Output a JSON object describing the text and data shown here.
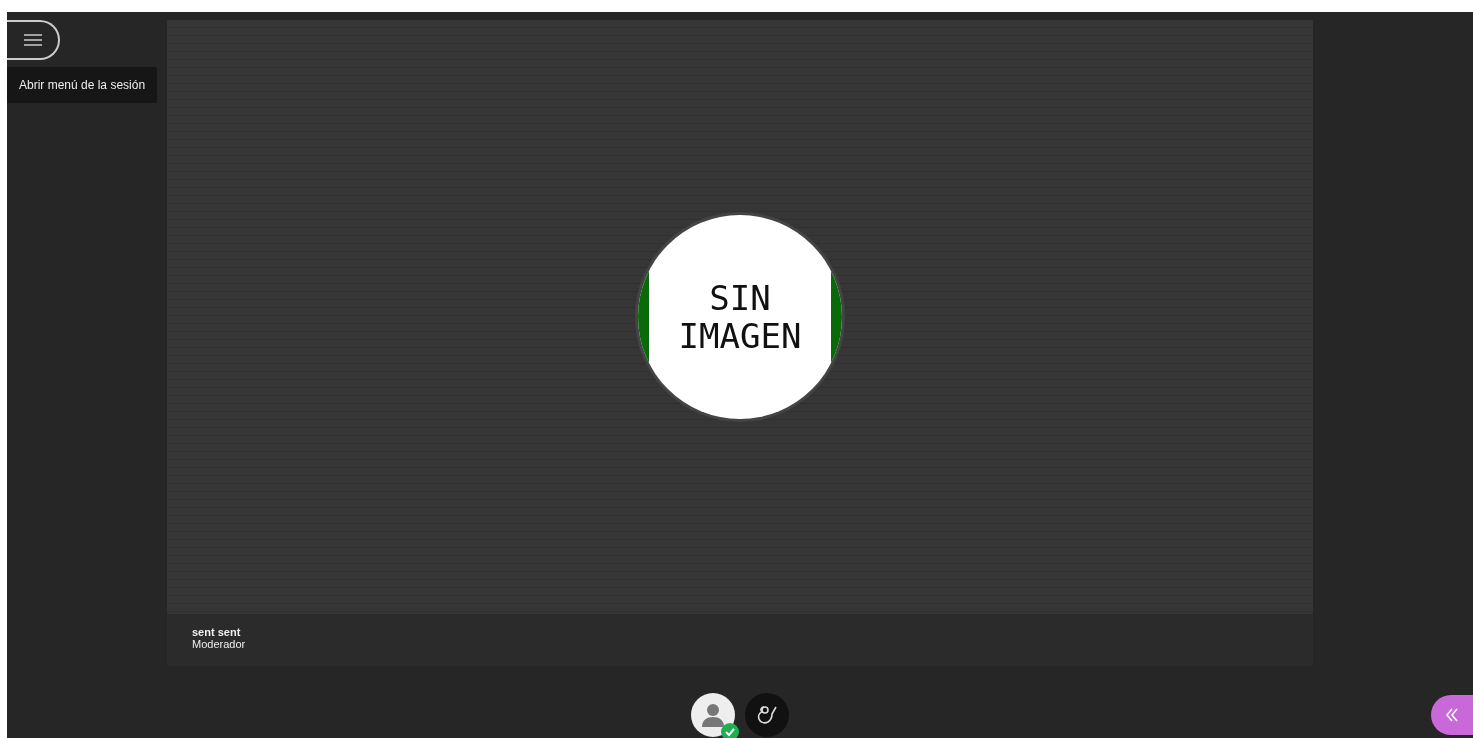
{
  "menu_button": {
    "tooltip": "Abrir menú de la sesión"
  },
  "video_tile": {
    "placeholder_text": [
      "SIN",
      "IMAGEN"
    ],
    "user_name": "sent sent",
    "role": "Moderador"
  },
  "controls": [
    {
      "kind": "avatar",
      "status_ok": true
    },
    {
      "kind": "raise_hand"
    }
  ],
  "side_panel_toggle": {
    "expanded": false
  }
}
